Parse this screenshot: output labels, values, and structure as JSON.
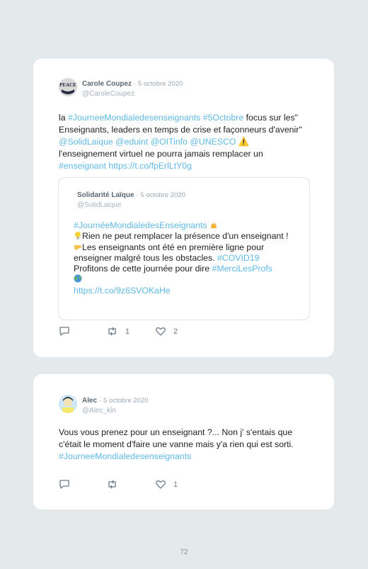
{
  "tweets": [
    {
      "author": "Carole Coupez",
      "date": "5 octobre 2020",
      "handle": "@CaroleCoupez",
      "avatar_text": "PEACE",
      "text": {
        "p1": "la ",
        "l1": "#JourneeMondialedesenseignants #5Octobre",
        "p2": " focus sur les\" Enseignants, leaders en temps de crise et façonneurs d'avenir\" ",
        "l2": "@SolidLaique @eduint @OITinfo @UNESCO",
        "p3": " ⚠️\nl'enseignement virtuel ne pourra jamais remplacer un ",
        "l3": "#enseignant https://t.co/fpErlLtY0g"
      },
      "quoted": {
        "author": "Solidarité Laïque",
        "date": "5 octobre 2020",
        "handle": "@SolidLaique",
        "hashtag": "#JournéeMondialedesEnseignants",
        "line2": "Rien ne peut remplacer la présence d'un enseignant !",
        "line3": "Les enseignants ont été en première ligne pour enseigner malgré tous les obstacles. ",
        "covid": "#COVID19",
        "line4": "Profitons de cette journée pour dire ",
        "merci": "#MerciLesProfs",
        "url": "https://t.co/9z6SVOKaHe"
      },
      "retweets": "1",
      "likes": "2"
    },
    {
      "author": "Alec",
      "date": "5 octobre 2020",
      "handle": "@Alec_kln",
      "text": {
        "p1": "Vous vous prenez pour un enseignant ?... Non j' s'entais que c'était le moment d'faire une vanne mais y'a rien qui est sorti. ",
        "l1": "#JourneeMondialedesenseignants"
      },
      "retweets": "",
      "likes": "1"
    }
  ],
  "page_number": "72",
  "colors": {
    "link": "#5fb9e6",
    "background": "#e4e9ec"
  }
}
